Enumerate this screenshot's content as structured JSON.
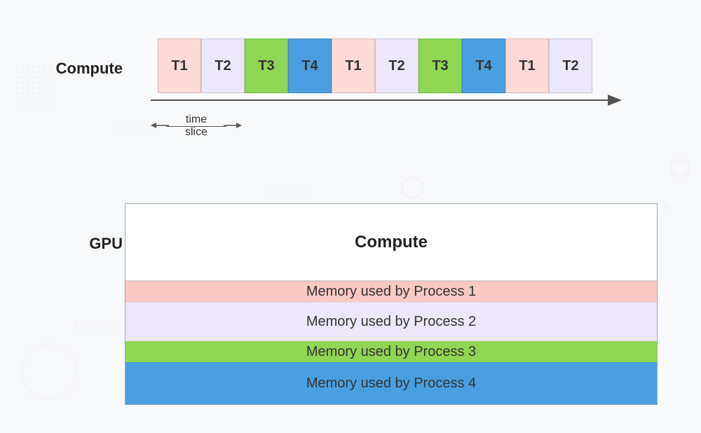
{
  "labels": {
    "compute": "Compute",
    "gpu": "GPU"
  },
  "timeline": {
    "slots": [
      {
        "label": "T1",
        "color": "pink"
      },
      {
        "label": "T2",
        "color": "lav"
      },
      {
        "label": "T3",
        "color": "green"
      },
      {
        "label": "T4",
        "color": "blue"
      },
      {
        "label": "T1",
        "color": "pink"
      },
      {
        "label": "T2",
        "color": "lav"
      },
      {
        "label": "T3",
        "color": "green"
      },
      {
        "label": "T4",
        "color": "blue"
      },
      {
        "label": "T1",
        "color": "pink"
      },
      {
        "label": "T2",
        "color": "lav"
      }
    ],
    "time_slice_top": "time",
    "time_slice_bottom": "slice"
  },
  "gpu": {
    "compute_label": "Compute",
    "memory_rows": [
      {
        "label": "Memory used by Process 1"
      },
      {
        "label": "Memory used by Process 2"
      },
      {
        "label": "Memory used by Process 3"
      },
      {
        "label": "Memory used by Process 4"
      }
    ]
  },
  "colors": {
    "pink": "#fcdad6",
    "lav": "#ede7fb",
    "green": "#8ed653",
    "blue": "#4a9fe0"
  }
}
